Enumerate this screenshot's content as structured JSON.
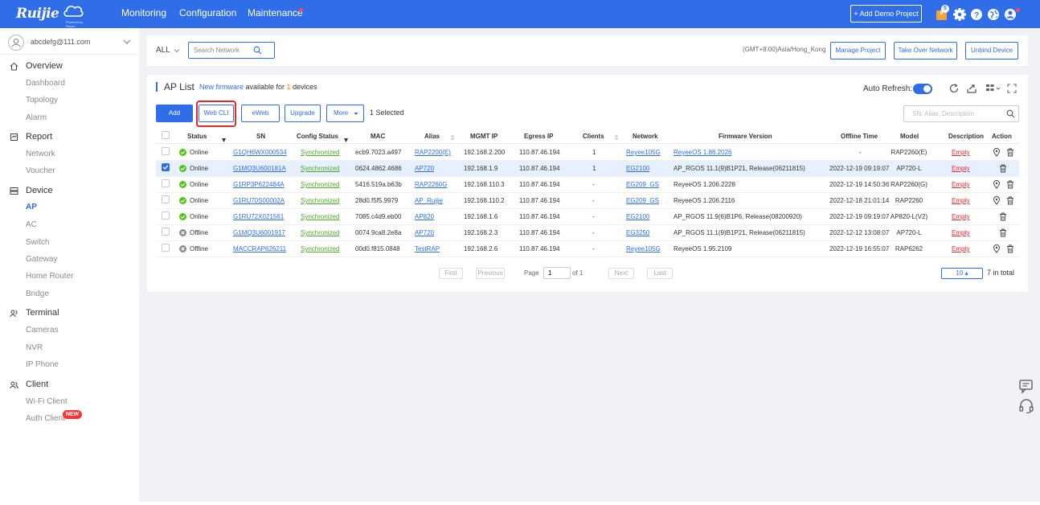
{
  "header": {
    "logo_text": "Ruijie",
    "logo_sub": "Powered by Reyee",
    "nav": [
      "Monitoring",
      "Configuration",
      "Maintenance"
    ],
    "add_demo_label": "+ Add Demo Project",
    "notification_count": "5",
    "icons": [
      "package-icon",
      "gear-icon",
      "help-icon",
      "globe-icon",
      "user-icon"
    ]
  },
  "sidebar": {
    "user_email": "abcdefg@111.com",
    "groups": [
      {
        "label": "Overview",
        "icon": "home-icon",
        "items": [
          "Dashboard",
          "Topology",
          "Alarm"
        ]
      },
      {
        "label": "Report",
        "icon": "report-icon",
        "items": [
          "Network",
          "Voucher"
        ]
      },
      {
        "label": "Device",
        "icon": "device-icon",
        "items": [
          "AP",
          "AC",
          "Switch",
          "Gateway",
          "Home Router",
          "Bridge"
        ]
      },
      {
        "label": "Terminal",
        "icon": "terminal-icon",
        "items": [
          "Cameras",
          "NVR",
          "IP Phone"
        ]
      },
      {
        "label": "Client",
        "icon": "client-icon",
        "items": [
          "Wi-Fi Client",
          "Auth Client"
        ]
      }
    ],
    "active_item": "AP",
    "new_badge": "NEW"
  },
  "filter": {
    "scope": "ALL",
    "search_placeholder": "Search Network",
    "timezone": "(GMT+8:00)Asia/Hong_Kong",
    "buttons": [
      "Manage Project",
      "Take Over Network",
      "Unbind Device"
    ]
  },
  "panel": {
    "title": "AP List",
    "firmware_link": "New firmware",
    "firmware_mid": " available for ",
    "firmware_count": "1",
    "firmware_end": " devices",
    "auto_refresh_label": "Auto Refresh:",
    "auto_refresh_on": true,
    "actions": [
      "Add",
      "Web CLI",
      "eWeb",
      "Upgrade",
      "More"
    ],
    "selected_text": "1 Selected",
    "sn_search_placeholder": "SN, Alias, Description"
  },
  "table": {
    "columns": [
      "Status",
      "SN",
      "Config Status",
      "MAC",
      "Alias",
      "MGMT IP",
      "Egress IP",
      "Clients",
      "Network",
      "Firmware Version",
      "Offline Time",
      "Model",
      "Description",
      "Action"
    ],
    "rows": [
      {
        "status": "Online",
        "sn": "G1QH6WX000534",
        "config": "Synchronized",
        "mac": "ecb9.7023.a497",
        "alias": "RAP2200(E)",
        "mgmt_ip": "192.168.2.200",
        "egress_ip": "110.87.46.194",
        "clients": "1",
        "network": "Reyee105G",
        "firmware": "ReyeeOS 1.86.2026",
        "firmware_link": true,
        "offline": "-",
        "model": "RAP2260(E)",
        "desc": "Empty",
        "selected": false,
        "has_locate": true
      },
      {
        "status": "Online",
        "sn": "G1MQ3U600181A",
        "config": "Synchronized",
        "mac": "0624.4862.4686",
        "alias": "AP720",
        "mgmt_ip": "192.168.1.9",
        "egress_ip": "110.87.46.194",
        "clients": "1",
        "network": "EG2100",
        "firmware": "AP_RGOS 11.1(9)B1P21, Release(06211815)",
        "firmware_link": false,
        "offline": "2022-12-19 09:19:07",
        "model": "AP720-L",
        "desc": "Empty",
        "selected": true,
        "has_locate": false
      },
      {
        "status": "Online",
        "sn": "G1RP3P622484A",
        "config": "Synchronized",
        "mac": "5416.519a.b63b",
        "alias": "RAP2260G",
        "mgmt_ip": "192.168.110.3",
        "egress_ip": "110.87.46.194",
        "clients": "-",
        "network": "EG209_GS",
        "firmware": "ReyeeOS 1.206.2228",
        "firmware_link": false,
        "offline": "2022-12-19 14:50:36",
        "model": "RAP2260(G)",
        "desc": "Empty",
        "selected": false,
        "has_locate": true
      },
      {
        "status": "Online",
        "sn": "G1RU70S00002A",
        "config": "Synchronized",
        "mac": "28d0.f5f5.9979",
        "alias": "AP_Ruijie",
        "mgmt_ip": "192.168.110.2",
        "egress_ip": "110.87.46.194",
        "clients": "-",
        "network": "EG209_GS",
        "firmware": "ReyeeOS 1.206.2116",
        "firmware_link": false,
        "offline": "2022-12-18 21:01:14",
        "model": "RAP2260",
        "desc": "Empty",
        "selected": false,
        "has_locate": true
      },
      {
        "status": "Online",
        "sn": "G1RU72X021561",
        "config": "Synchronized",
        "mac": "7085.c4d9.eb00",
        "alias": "AP820",
        "mgmt_ip": "192.168.1.6",
        "egress_ip": "110.87.46.194",
        "clients": "-",
        "network": "EG2100",
        "firmware": "AP_RGOS 11.9(6)B1P6, Release(08200920)",
        "firmware_link": false,
        "offline": "2022-12-19 09:19:07",
        "model": "AP820-L(V2)",
        "desc": "Empty",
        "selected": false,
        "has_locate": false
      },
      {
        "status": "Offline",
        "sn": "G1MQ3U6001917",
        "config": "Synchronized",
        "mac": "0074.9ca8.2e8a",
        "alias": "AP720",
        "mgmt_ip": "192.168.2.3",
        "egress_ip": "110.87.46.194",
        "clients": "-",
        "network": "EG3250",
        "firmware": "AP_RGOS 11.1(9)B1P21, Release(06211815)",
        "firmware_link": false,
        "offline": "2022-12-12 13:08:07",
        "model": "AP720-L",
        "desc": "Empty",
        "selected": false,
        "has_locate": false
      },
      {
        "status": "Offline",
        "sn": "MACCRAP626211",
        "config": "Synchronized",
        "mac": "00d0.f815.0848",
        "alias": "TestRAP",
        "mgmt_ip": "192.168.2.6",
        "egress_ip": "110.87.46.194",
        "clients": "-",
        "network": "Reyee105G",
        "firmware": "ReyeeOS 1.95.2109",
        "firmware_link": false,
        "offline": "2022-12-19 16:55:07",
        "model": "RAP6262",
        "desc": "Empty",
        "selected": false,
        "has_locate": true
      }
    ]
  },
  "pagination": {
    "first": "First",
    "previous": "Previous",
    "page_label": "Page",
    "page_value": "1",
    "of_label": "of 1",
    "next": "Next",
    "last": "Last",
    "per_page": "10",
    "total": "7 in total"
  },
  "colors": {
    "primary": "#2f6ee8",
    "online": "#52c41a",
    "offline": "#8c8c8c",
    "alert": "#e02b2b"
  }
}
